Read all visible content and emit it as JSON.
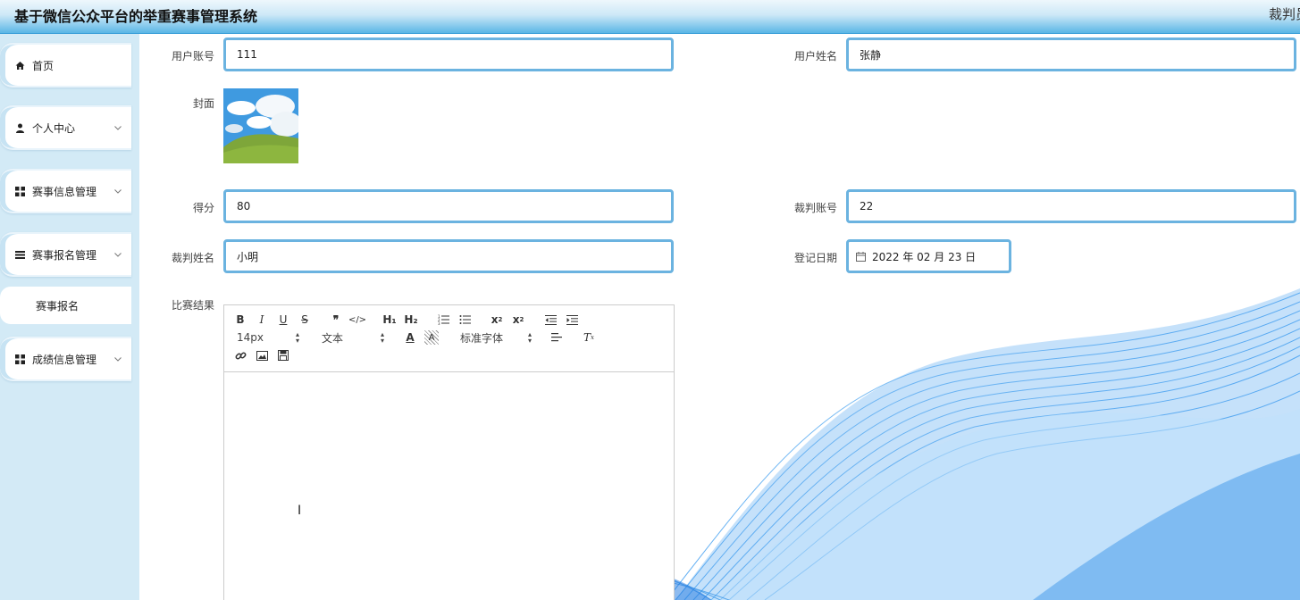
{
  "header": {
    "title": "基于微信公众平台的举重赛事管理系统",
    "user": "裁判员"
  },
  "sidebar": {
    "items": [
      {
        "label": "首页",
        "icon": "home-icon"
      },
      {
        "label": "个人中心",
        "icon": "user-icon"
      },
      {
        "label": "赛事信息管理",
        "icon": "grid-icon"
      },
      {
        "label": "赛事报名管理",
        "icon": "list-icon"
      },
      {
        "label": "成绩信息管理",
        "icon": "grid-icon"
      }
    ],
    "sub_item": "赛事报名"
  },
  "form": {
    "account_label": "用户账号",
    "account_value": "111",
    "name_label": "用户姓名",
    "name_value": "张静",
    "cover_label": "封面",
    "score_label": "得分",
    "score_value": "80",
    "judge_account_label": "裁判账号",
    "judge_account_value": "22",
    "judge_name_label": "裁判姓名",
    "judge_name_value": "小明",
    "date_label": "登记日期",
    "date_value": "2022 年 02 月 23 日",
    "result_label": "比赛结果"
  },
  "editor": {
    "font_size": "14px",
    "text_type": "文本",
    "font_family": "标准字体",
    "h1": "H₁",
    "h2": "H₂"
  },
  "colors": {
    "accent": "#6bb3e0",
    "sidebar_bg": "#d3eaf6",
    "header_bottom": "#5ab6e6"
  }
}
